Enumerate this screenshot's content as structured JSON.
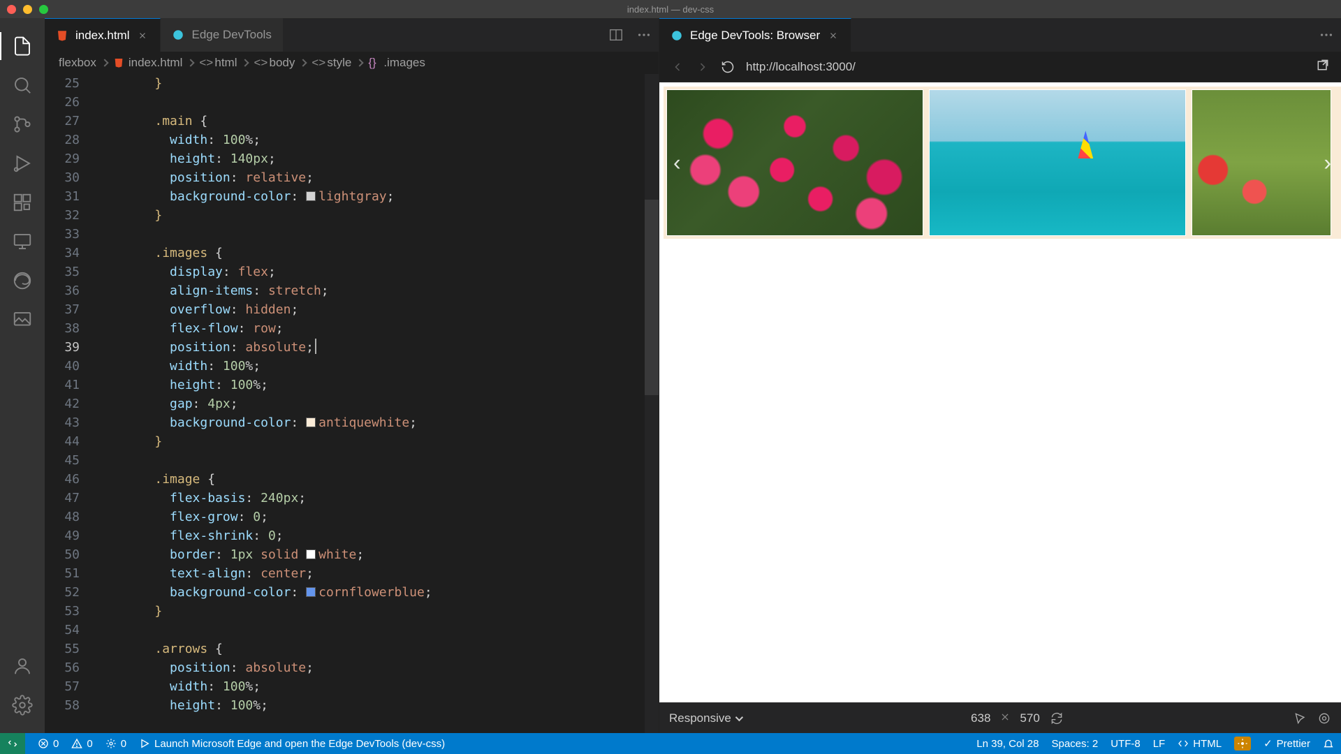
{
  "window": {
    "title": "index.html — dev-css"
  },
  "tabs_left": [
    {
      "label": "index.html",
      "icon": "html",
      "active": true,
      "dirty": false
    },
    {
      "label": "Edge DevTools",
      "icon": "edge",
      "active": false
    }
  ],
  "tabs_right": [
    {
      "label": "Edge DevTools: Browser",
      "icon": "edge",
      "active": true
    }
  ],
  "breadcrumbs": [
    "flexbox",
    "index.html",
    "html",
    "body",
    "style",
    ".images"
  ],
  "editor": {
    "first_line": 25,
    "active_line": 39,
    "lines": [
      "    }",
      "",
      "    .main {",
      "      width: 100%;",
      "      height: 140px;",
      "      position: relative;",
      "      background-color: ▢lightgray;",
      "    }",
      "",
      "    .images {",
      "      display: flex;",
      "      align-items: stretch;",
      "      overflow: hidden;",
      "      flex-flow: row;",
      "      position: absolute;|",
      "      width: 100%;",
      "      height: 100%;",
      "      gap: 4px;",
      "      background-color: ▢antiquewhite;",
      "    }",
      "",
      "    .image {",
      "      flex-basis: 240px;",
      "      flex-grow: 0;",
      "      flex-shrink: 0;",
      "      border: 1px solid ▢white;",
      "      text-align: center;",
      "      background-color: ▢cornflowerblue;",
      "    }",
      "",
      "    .arrows {",
      "      position: absolute;",
      "      width: 100%;",
      "      height: 100%;"
    ]
  },
  "browser": {
    "url": "http://localhost:3000/",
    "responsive_label": "Responsive",
    "width": "638",
    "height": "570"
  },
  "statusbar": {
    "remote": "",
    "errors": "0",
    "warnings": "0",
    "ports": "0",
    "launch_text": "Launch Microsoft Edge and open the Edge DevTools (dev-css)",
    "cursor": "Ln 39, Col 28",
    "spaces": "Spaces: 2",
    "encoding": "UTF-8",
    "eol": "LF",
    "language": "HTML",
    "prettier": "Prettier"
  },
  "colors": {
    "lightgray": "#d3d3d3",
    "antiquewhite": "#faebd7",
    "white": "#ffffff",
    "cornflowerblue": "#6495ed"
  }
}
